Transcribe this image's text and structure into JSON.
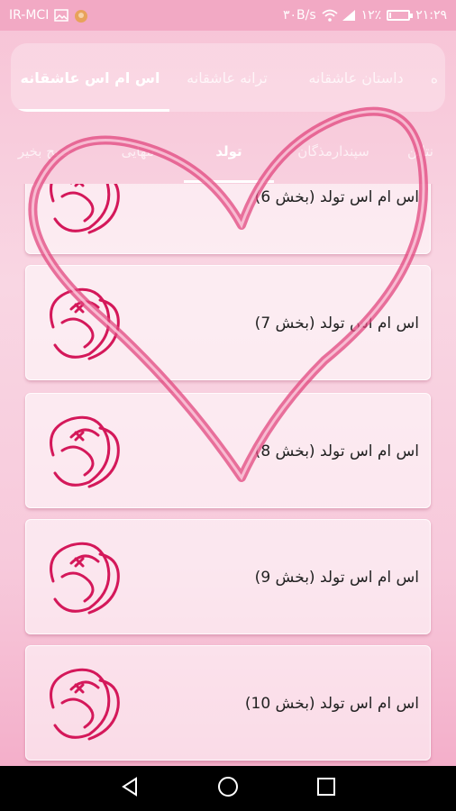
{
  "status_bar": {
    "carrier": "IR-MCI",
    "speed": "۳۰B/s",
    "signal_label": "۱۲٪",
    "time": "۲۱:۲۹",
    "battery_level": 0.12
  },
  "top_tabs": [
    {
      "label": "اس ام اس عاشقانه",
      "active": true
    },
    {
      "label": "ترانه عاشقانه",
      "active": false
    },
    {
      "label": "داستان عاشقانه",
      "active": false
    },
    {
      "label": "ه",
      "active": false
    }
  ],
  "sub_tabs": [
    {
      "label": "صبح بخیر",
      "active": false
    },
    {
      "label": "تنهایی",
      "active": false
    },
    {
      "label": "تولد",
      "active": true
    },
    {
      "label": "سپندارمذگان",
      "active": false
    },
    {
      "label": "نتاین",
      "active": false
    }
  ],
  "list_items": [
    {
      "title": "اس ام اس تولد (بخش 6)"
    },
    {
      "title": "اس ام اس تولد (بخش 7)"
    },
    {
      "title": "اس ام اس تولد (بخش 8)"
    },
    {
      "title": "اس ام اس تولد (بخش 9)"
    },
    {
      "title": "اس ام اس تولد (بخش 10)"
    }
  ],
  "colors": {
    "accent": "#d91e5b",
    "status_bar": "#f2a9c4",
    "background": "#f9d6e3"
  },
  "icons": {
    "back": "back-icon",
    "home": "home-icon",
    "recents": "recents-icon"
  }
}
